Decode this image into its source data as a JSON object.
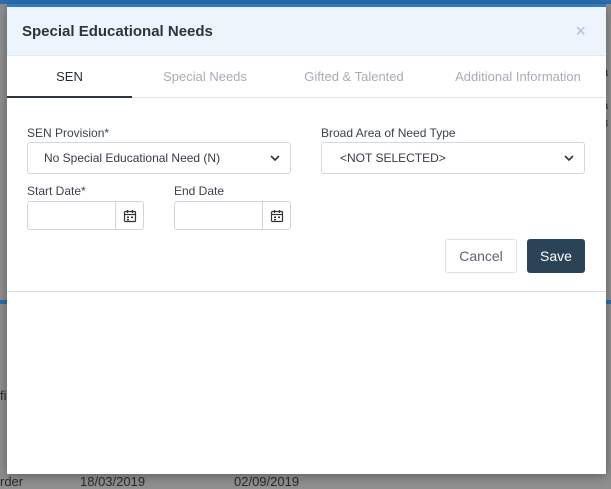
{
  "modal": {
    "title": "Special Educational Needs",
    "close_icon": "×"
  },
  "tabs": [
    {
      "label": "SEN",
      "active": true
    },
    {
      "label": "Special Needs",
      "active": false
    },
    {
      "label": "Gifted & Talented",
      "active": false
    },
    {
      "label": "Additional Information",
      "active": false
    }
  ],
  "form": {
    "sen_provision": {
      "label": "SEN Provision*",
      "value": "No Special Educational Need (N)"
    },
    "need_type": {
      "label": "Broad Area of Need Type",
      "value": "<NOT SELECTED>"
    },
    "start_date": {
      "label": "Start Date*",
      "value": ""
    },
    "end_date": {
      "label": "End Date",
      "value": ""
    }
  },
  "actions": {
    "cancel_label": "Cancel",
    "save_label": "Save"
  },
  "background": {
    "right_fragment_top": "a",
    "right_fragment_mid": "a",
    "right_fragment_low": "3",
    "left_fragment": "fi",
    "bottom_row": [
      "rder",
      "18/03/2019",
      "02/09/2019"
    ]
  },
  "colors": {
    "accent": "#2f7cc4",
    "save_button": "#2b4356",
    "header_bg": "#eef4fb"
  }
}
